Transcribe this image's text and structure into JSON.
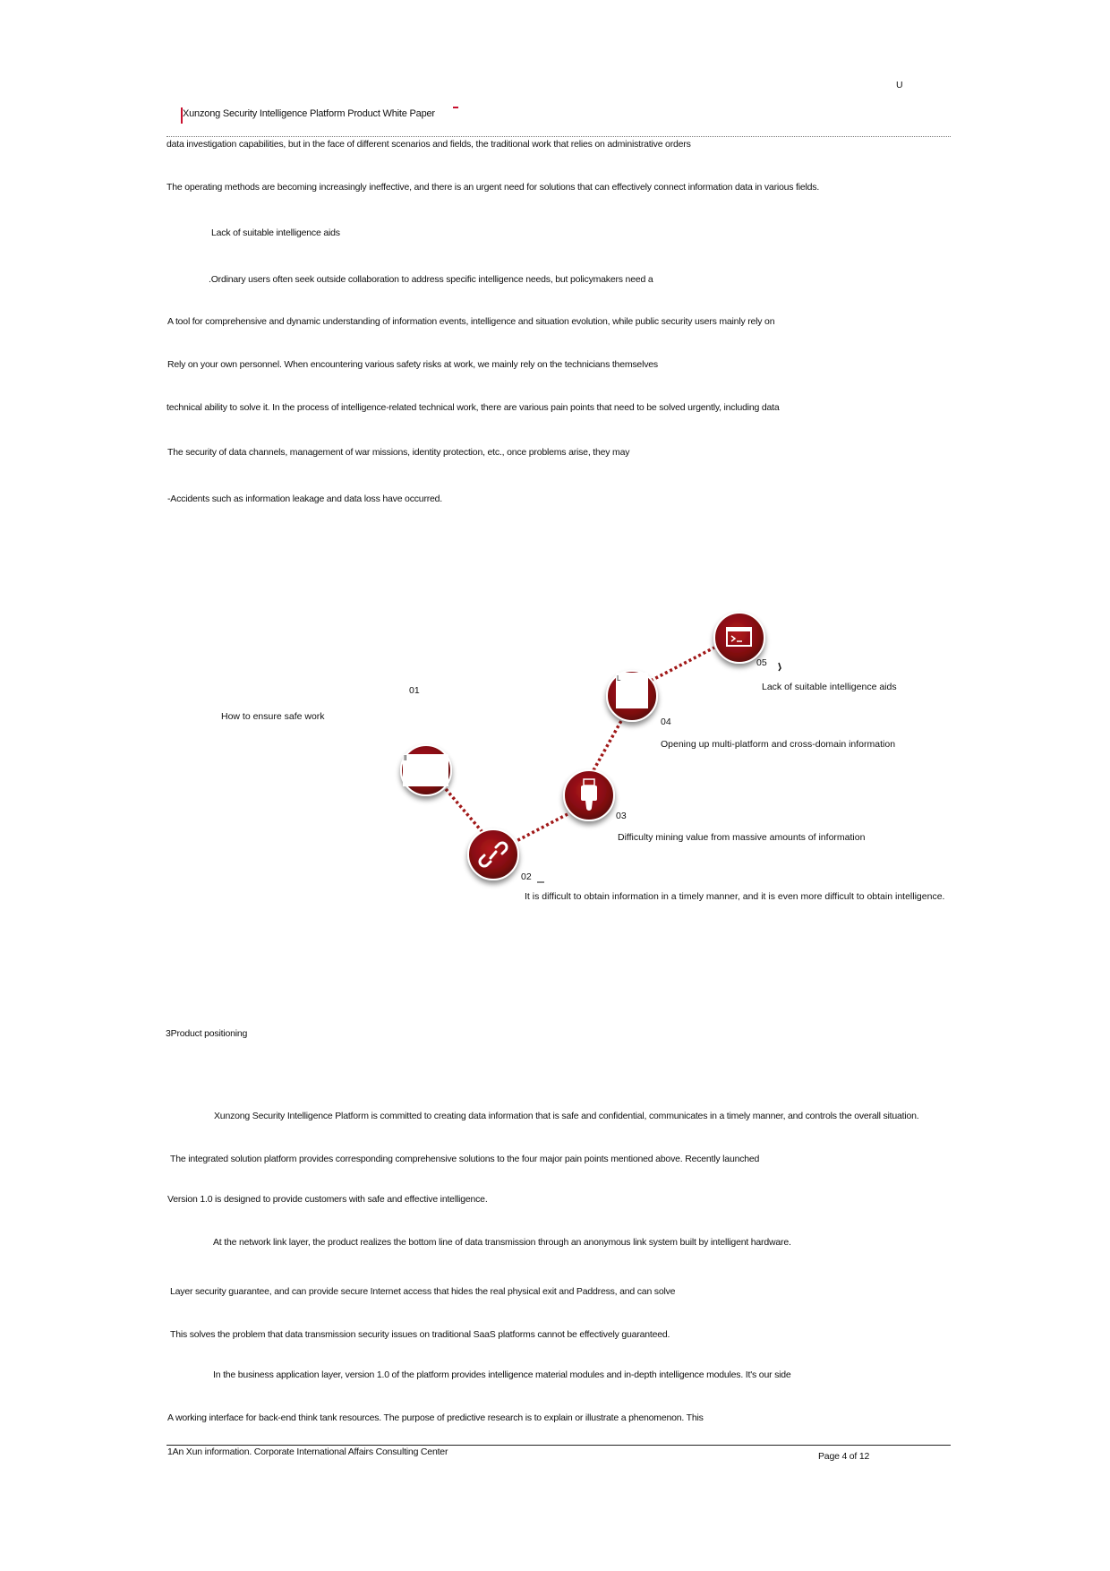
{
  "header": {
    "corner_mark": "U",
    "title": "Xunzong Security Intelligence Platform Product White Paper"
  },
  "paragraphs": {
    "p1": "data investigation capabilities, but in the face of different scenarios and fields, the traditional work that relies on administrative orders",
    "p2": "The operating methods are becoming increasingly ineffective, and there is an urgent need for solutions that can effectively connect information data in various fields.",
    "p3": "Lack of suitable intelligence aids",
    "p4": ".Ordinary users often seek outside collaboration to address specific intelligence needs, but policymakers need a",
    "p5": "A tool for comprehensive and dynamic understanding of information events, intelligence and situation evolution, while public security users mainly rely on",
    "p6": "Rely on your own personnel. When encountering various safety risks at work, we mainly rely on the technicians themselves",
    "p7": "technical ability to solve it. In the process of intelligence-related technical work, there are various pain points that need to be solved urgently, including data",
    "p8": "The security of data channels, management of war missions, identity protection, etc., once problems arise, they may",
    "p9": "-Accidents such as information leakage and data loss have occurred."
  },
  "diagram": {
    "nodes": [
      {
        "num": "01",
        "label": "How to ensure safe work",
        "icon": "image-placeholder-icon"
      },
      {
        "num": "02",
        "label": "It is difficult to obtain information in a timely manner, and it is even more difficult to obtain intelligence.",
        "icon": "broken-link-icon"
      },
      {
        "num": "03",
        "label": "Difficulty mining value from massive amounts of information",
        "icon": "usb-drive-icon"
      },
      {
        "num": "04",
        "label": "Opening up multi-platform and cross-domain information",
        "icon": "image-placeholder-icon"
      },
      {
        "num": "05",
        "label": "Lack of suitable intelligence aids",
        "icon": "terminal-icon"
      }
    ],
    "node_color": "#8b0f14",
    "connector_color": "#a01818"
  },
  "section": {
    "heading": "3Product positioning"
  },
  "body2": {
    "p1": "Xunzong Security Intelligence Platform is committed to creating data information that is safe and confidential, communicates in a timely manner, and controls the overall situation.",
    "p2": "The integrated solution platform provides corresponding comprehensive solutions to the four major pain points mentioned above. Recently launched",
    "p3": "Version 1.0 is designed to provide customers with safe and effective intelligence.",
    "p4": "At the network link layer, the product realizes the bottom line of data transmission through an anonymous link system built by intelligent hardware.",
    "p5": "Layer security guarantee, and can provide secure Internet access that hides the real physical exit and Paddress, and can solve",
    "p6": "This solves the problem that data transmission security issues on traditional SaaS platforms cannot be effectively guaranteed.",
    "p7": "In the business application layer, version 1.0 of the platform provides intelligence material modules and in-depth intelligence modules. It's our side",
    "p8": "A working interface for back-end think tank resources. The purpose of predictive research is to explain or illustrate a phenomenon. This"
  },
  "footer": {
    "org": "1An Xun information. Corporate International Affairs Consulting Center",
    "page": "Page 4 of 12"
  }
}
